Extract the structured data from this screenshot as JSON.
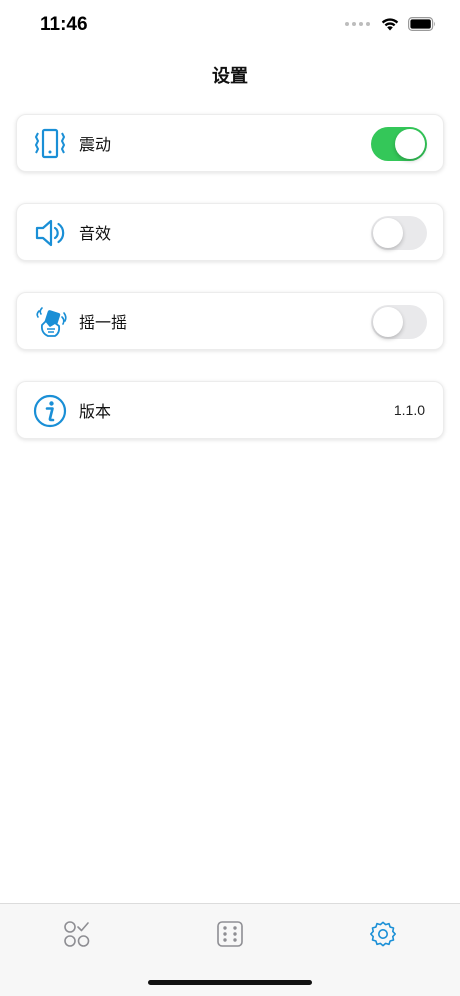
{
  "status_bar": {
    "time": "11:46"
  },
  "header": {
    "title": "设置"
  },
  "settings": {
    "vibration": {
      "label": "震动",
      "enabled": true,
      "icon": "vibration-icon"
    },
    "sound": {
      "label": "音效",
      "enabled": false,
      "icon": "speaker-icon"
    },
    "shake": {
      "label": "摇一摇",
      "enabled": false,
      "icon": "shake-hand-icon"
    },
    "version": {
      "label": "版本",
      "value": "1.1.0",
      "icon": "info-icon"
    }
  },
  "tab_bar": {
    "tabs": [
      {
        "icon": "shapes-check-icon",
        "active": false
      },
      {
        "icon": "dice-icon",
        "active": false
      },
      {
        "icon": "gear-icon",
        "active": true
      }
    ]
  },
  "colors": {
    "accent": "#1a8fd6",
    "toggle_on": "#34c759",
    "toggle_off": "#e9e9eb",
    "tab_inactive": "#8e8e93"
  }
}
